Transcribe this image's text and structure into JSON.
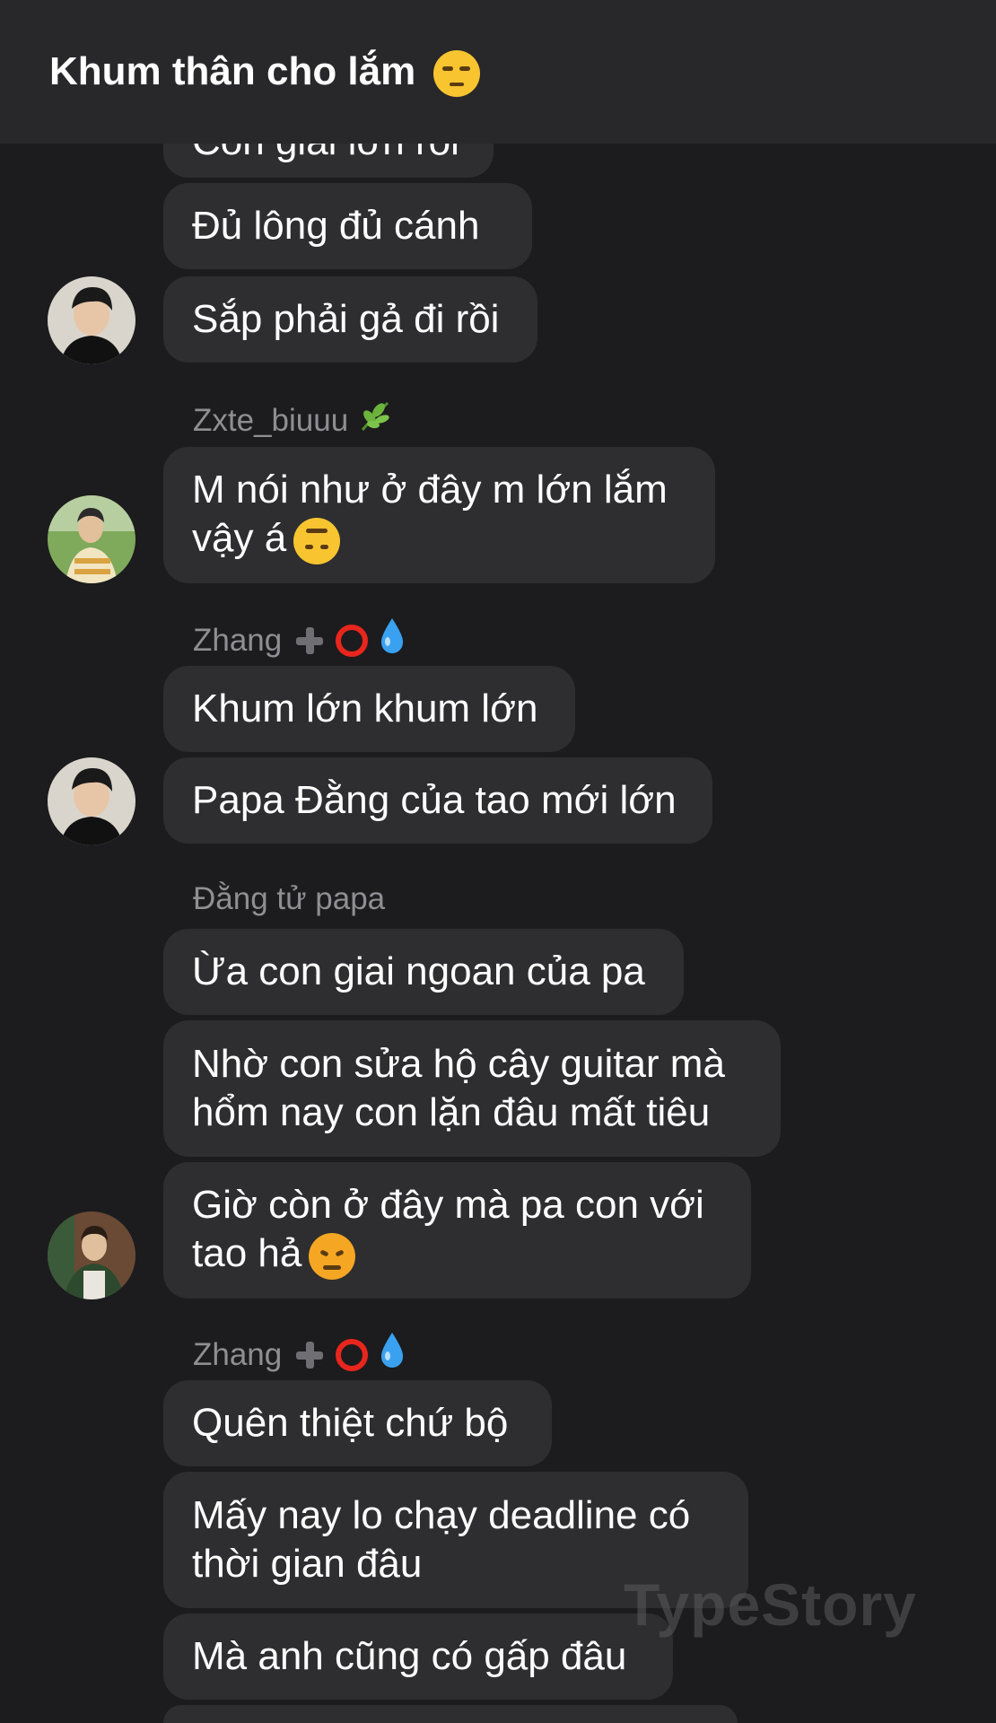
{
  "header": {
    "title": "Khum thân cho lắm"
  },
  "messages": [
    {
      "text": "Con giai lớn rồi"
    },
    {
      "text": "Đủ lông đủ cánh"
    },
    {
      "text": "Sắp phải gả đi rồi"
    },
    {
      "sender": "Zxte_biuuu",
      "text": "M nói như ở đây m lớn lắm\nvậy á"
    },
    {
      "sender": "Zhang",
      "text": "Khum lớn khum lớn"
    },
    {
      "text": "Papa Đằng của tao mới lớn"
    },
    {
      "sender": "Đằng tử papa",
      "text": "Ừa con giai ngoan của pa"
    },
    {
      "text": "Nhờ con sửa hộ cây guitar mà\nhổm nay con lặn đâu mất tiêu"
    },
    {
      "text": "Giờ còn ở đây mà pa con với\ntao hả"
    },
    {
      "sender": "Zhang",
      "text": "Quên thiệt chứ bộ"
    },
    {
      "text": "Mấy nay lo chạy deadline có\nthời gian đâu"
    },
    {
      "text": "Mà anh cũng có gấp đâu"
    }
  ],
  "watermark": "TypeStory",
  "icons": {
    "header_emoji": "unamused-face-icon",
    "leaf": "herb-icon",
    "plus": "heavy-plus-icon",
    "ring": "red-circle-icon",
    "drop": "droplet-icon",
    "upside_down": "upside-down-face-icon",
    "angry": "angry-face-icon"
  },
  "colors": {
    "background": "#1c1c1e",
    "header": "#28282a",
    "bubble": "#2e2e30",
    "sender": "#8e8e93"
  }
}
